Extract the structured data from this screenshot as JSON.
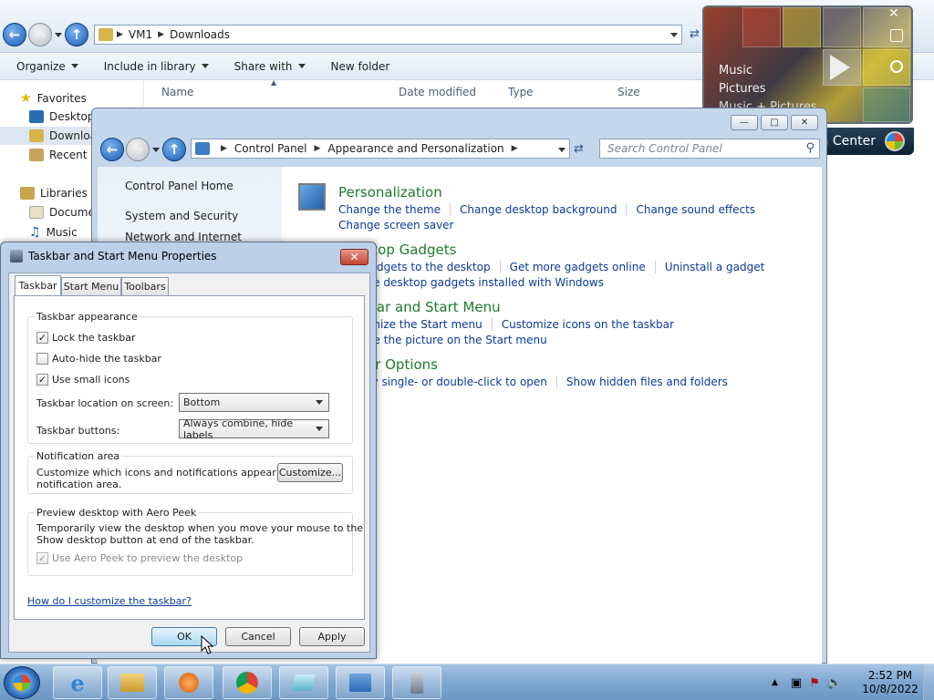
{
  "explorer": {
    "breadcrumb": [
      "VM1",
      "Downloads"
    ],
    "commands": [
      "Organize",
      "Include in library",
      "Share with",
      "New folder"
    ],
    "nav": {
      "favorites": "Favorites",
      "desktop": "Desktop",
      "downloads": "Downloads",
      "recent": "Recent Places",
      "libraries": "Libraries",
      "documents": "Documents",
      "music": "Music"
    },
    "columns": [
      "Name",
      "Date modified",
      "Type",
      "Size"
    ]
  },
  "gadget": {
    "items": [
      "Music",
      "Pictures",
      "Music + Pictures"
    ],
    "title": "Media Center"
  },
  "control_panel": {
    "breadcrumb": [
      "Control Panel",
      "Appearance and Personalization"
    ],
    "search_placeholder": "Search Control Panel",
    "left_nav": [
      "Control Panel Home",
      "System and Security",
      "Network and Internet"
    ],
    "categories": [
      {
        "title": "Personalization",
        "links": [
          "Change the theme",
          "Change desktop background",
          "Change sound effects"
        ],
        "links2": [
          "Change screen saver"
        ]
      },
      {
        "title": "Desktop Gadgets",
        "links": [
          "Add gadgets to the desktop",
          "Get more gadgets online",
          "Uninstall a gadget"
        ],
        "links2": [
          "Restore desktop gadgets installed with Windows"
        ]
      },
      {
        "title": "Taskbar and Start Menu",
        "links": [
          "Customize the Start menu",
          "Customize icons on the taskbar"
        ],
        "links2": [
          "Change the picture on the Start menu"
        ]
      },
      {
        "title": "Folder Options",
        "links": [
          "Specify single- or double-click to open",
          "Show hidden files and folders"
        ]
      }
    ]
  },
  "dialog": {
    "title": "Taskbar and Start Menu Properties",
    "tabs": [
      "Taskbar",
      "Start Menu",
      "Toolbars"
    ],
    "appearance": {
      "label": "Taskbar appearance",
      "lock": "Lock the taskbar",
      "autohide": "Auto-hide the taskbar",
      "small_icons": "Use small icons",
      "location_label": "Taskbar location on screen:",
      "location_value": "Bottom",
      "buttons_label": "Taskbar buttons:",
      "buttons_value": "Always combine, hide labels"
    },
    "notification": {
      "label": "Notification area",
      "text_line1": "Customize which icons and notifications appear in the",
      "text_line2": "notification area.",
      "customize": "Customize..."
    },
    "peek": {
      "label": "Preview desktop with Aero Peek",
      "text_line1": "Temporarily view the desktop when you move your mouse to the",
      "text_line2": "Show desktop button at end of the taskbar.",
      "checkbox": "Use Aero Peek to preview the desktop"
    },
    "help_link": "How do I customize the taskbar?",
    "buttons": {
      "ok": "OK",
      "cancel": "Cancel",
      "apply": "Apply"
    }
  },
  "taskbar": {
    "time": "2:52 PM",
    "date": "10/8/2022"
  }
}
